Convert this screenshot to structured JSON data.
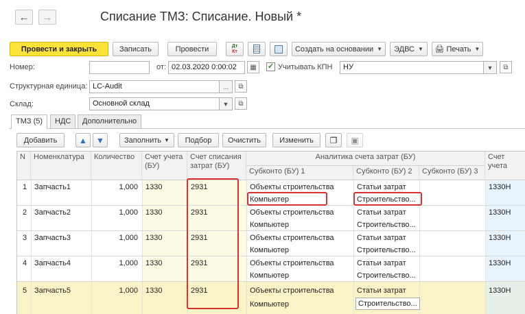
{
  "window": {
    "title": "Списание ТМЗ: Списание. Новый *",
    "back_icon": "arrow-left",
    "forward_icon": "arrow-right"
  },
  "toolbar": {
    "post_close": "Провести и закрыть",
    "save": "Записать",
    "post": "Провести",
    "dt_kt_top": "Дт",
    "dt_kt_bottom": "Кт",
    "create_based": "Создать на основании",
    "edvs": "ЭДВС",
    "print": "Печать"
  },
  "header": {
    "number_label": "Номер:",
    "number_value": "",
    "date_label": "от:",
    "date_value": "02.03.2020  0:00:02",
    "kpn_label": "Учитывать КПН",
    "kpn_checked": true,
    "kpn_value": "НУ",
    "unit_label": "Структурная единица:",
    "unit_value": "LC-Audit",
    "warehouse_label": "Склад:",
    "warehouse_value": "Основной склад"
  },
  "tabs": [
    "ТМЗ (5)",
    "НДС",
    "Дополнительно"
  ],
  "table_toolbar": {
    "add": "Добавить",
    "fill": "Заполнить",
    "select": "Подбор",
    "clear": "Очистить",
    "change": "Изменить"
  },
  "table": {
    "headers": {
      "n": "N",
      "item": "Номенклатура",
      "qty": "Количество",
      "account": "Счет учета (БУ)",
      "writeoff": "Счет списания затрат (БУ)",
      "analytics": "Аналитика счета затрат (БУ)",
      "sub1": "Субконто (БУ) 1",
      "sub2": "Субконто (БУ) 2",
      "sub3": "Субконто (БУ) 3",
      "account_nu": "Счет учета"
    },
    "rows": [
      {
        "n": "1",
        "item": "Запчасть1",
        "qty": "1,000",
        "account": "1330",
        "writeoff": "2931",
        "sub1a": "Объекты строительства",
        "sub1b": "Компьютер",
        "sub2a": "Статьи затрат",
        "sub2b": "Строительство...",
        "account_nu": "1330Н"
      },
      {
        "n": "2",
        "item": "Запчасть2",
        "qty": "1,000",
        "account": "1330",
        "writeoff": "2931",
        "sub1a": "Объекты строительства",
        "sub1b": "Компьютер",
        "sub2a": "Статьи затрат",
        "sub2b": "Строительство...",
        "account_nu": "1330Н"
      },
      {
        "n": "3",
        "item": "Запчасть3",
        "qty": "1,000",
        "account": "1330",
        "writeoff": "2931",
        "sub1a": "Объекты строительства",
        "sub1b": "Компьютер",
        "sub2a": "Статьи затрат",
        "sub2b": "Строительство...",
        "account_nu": "1330Н"
      },
      {
        "n": "4",
        "item": "Запчасть4",
        "qty": "1,000",
        "account": "1330",
        "writeoff": "2931",
        "sub1a": "Объекты строительства",
        "sub1b": "Компьютер",
        "sub2a": "Статьи затрат",
        "sub2b": "Строительство...",
        "account_nu": "1330Н"
      },
      {
        "n": "5",
        "item": "Запчасть5",
        "qty": "1,000",
        "account": "1330",
        "writeoff": "2931",
        "sub1a": "Объекты строительства",
        "sub1b": "Компьютер",
        "sub2a": "Статьи затрат",
        "sub2b": "Строительство...",
        "account_nu": "1330Н"
      }
    ]
  },
  "colors": {
    "primary_button": "#ffe338",
    "editable_column": "#fdfbe4",
    "selected_row": "#fbf3c8",
    "nu_column": "#e8f4fd",
    "highlight": "#d93030"
  }
}
